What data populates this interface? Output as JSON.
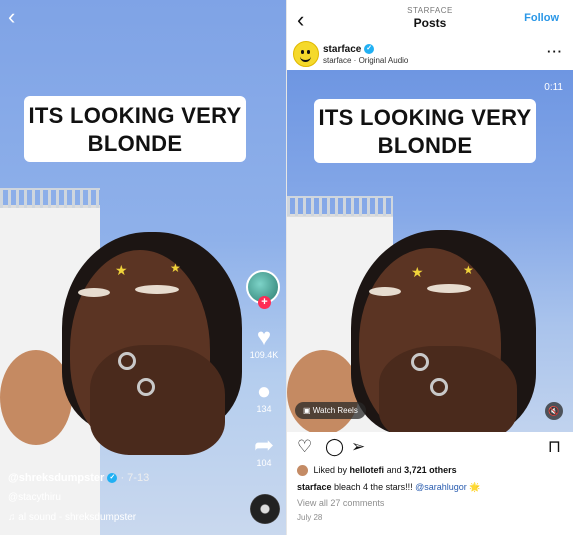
{
  "tiktok": {
    "overlay_text_line1": "ITS LOOKING VERY",
    "overlay_text_line2": "BLONDE",
    "like_count": "109.4K",
    "comment_count": "134",
    "share_count": "104",
    "username": "@shreksdumpster",
    "date": "· 7-13",
    "caption_mention": "@stacythiru",
    "sound_label": "al sound - shreksdumpster"
  },
  "instagram": {
    "header_subtitle": "STARFACE",
    "header_title": "Posts",
    "follow_label": "Follow",
    "account_name": "starface",
    "audio_label": "starface · Original Audio",
    "video_time": "0:11",
    "overlay_text_line1": "ITS LOOKING VERY",
    "overlay_text_line2": "BLONDE",
    "watch_reels_label": "Watch Reels",
    "liked_by_prefix": "Liked by ",
    "liked_by_user": "hellotefi",
    "liked_by_suffix": " and ",
    "liked_by_count": "3,721 others",
    "caption_user": "starface",
    "caption_text": " bleach 4 the stars!!! ",
    "caption_mention": "@sarahlugor",
    "caption_emoji": "🌟",
    "comments_link": "View all 27 comments",
    "post_date": "July 28"
  },
  "colors": {
    "tiktok_plus": "#fe2c55",
    "follow_blue": "#2a97e7",
    "verified_blue": "#21b0f3",
    "star_yellow": "#f0d33a"
  },
  "icons": [
    "back-chevron-icon",
    "heart-icon",
    "comment-icon",
    "share-icon",
    "music-note-icon",
    "more-icon",
    "send-icon",
    "bookmark-icon",
    "mute-icon",
    "reels-icon",
    "verified-icon"
  ]
}
